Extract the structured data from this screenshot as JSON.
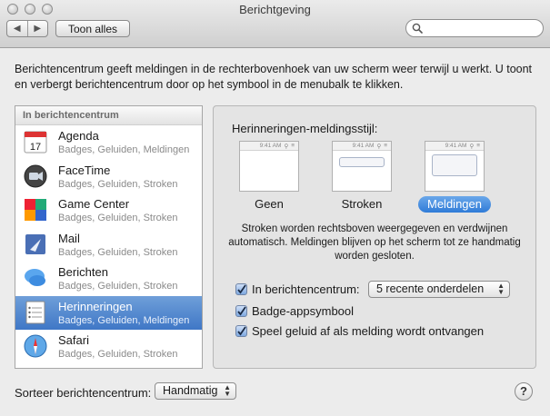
{
  "window": {
    "title": "Berichtgeving"
  },
  "toolbar": {
    "back_glyph": "◀",
    "forward_glyph": "▶",
    "show_all_label": "Toon alles",
    "search_placeholder": ""
  },
  "intro_text": "Berichtencentrum geeft meldingen in de rechterbovenhoek van uw scherm weer terwijl u werkt. U toont en verbergt berichtencentrum door op het symbool in de menubalk te klikken.",
  "sidebar": {
    "header": "In berichtencentrum",
    "items": [
      {
        "name": "Agenda",
        "subtitle": "Badges, Geluiden, Meldingen",
        "icon": "calendar-icon",
        "selected": false
      },
      {
        "name": "FaceTime",
        "subtitle": "Badges, Geluiden, Stroken",
        "icon": "facetime-icon",
        "selected": false
      },
      {
        "name": "Game Center",
        "subtitle": "Badges, Geluiden, Stroken",
        "icon": "game-center-icon",
        "selected": false
      },
      {
        "name": "Mail",
        "subtitle": "Badges, Geluiden, Stroken",
        "icon": "mail-icon",
        "selected": false
      },
      {
        "name": "Berichten",
        "subtitle": "Badges, Geluiden, Stroken",
        "icon": "messages-icon",
        "selected": false
      },
      {
        "name": "Herinneringen",
        "subtitle": "Badges, Geluiden, Meldingen",
        "icon": "reminders-icon",
        "selected": true
      },
      {
        "name": "Safari",
        "subtitle": "Badges, Geluiden, Stroken",
        "icon": "safari-icon",
        "selected": false
      }
    ]
  },
  "panel": {
    "style_label": "Herinneringen-meldingsstijl:",
    "thumb_time": "9:41 AM",
    "styles": [
      {
        "label": "Geen",
        "selected": false
      },
      {
        "label": "Stroken",
        "selected": false
      },
      {
        "label": "Meldingen",
        "selected": true
      }
    ],
    "description": "Stroken worden rechtsboven weergegeven en verdwijnen automatisch. Meldingen blijven op het scherm tot ze handmatig worden gesloten.",
    "options": {
      "in_center": {
        "label": "In berichtencentrum:",
        "checked": true
      },
      "recent_items": "5 recente onderdelen",
      "badge": {
        "label": "Badge-appsymbool",
        "checked": true
      },
      "sound": {
        "label": "Speel geluid af als melding wordt ontvangen",
        "checked": true
      }
    }
  },
  "footer": {
    "sort_label": "Sorteer berichtencentrum:",
    "sort_value": "Handmatig",
    "help_glyph": "?"
  },
  "colors": {
    "selection": "#3f77c6",
    "accent": "#2f7bd8",
    "window_bg": "#ececec"
  }
}
